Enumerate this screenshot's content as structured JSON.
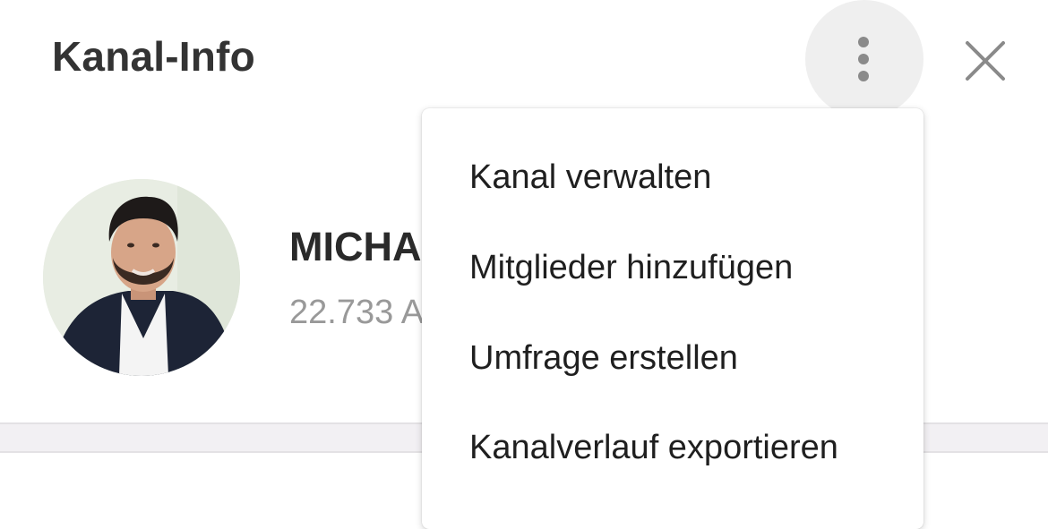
{
  "header": {
    "title": "Kanal-Info",
    "more_icon": "more-vertical-icon",
    "close_icon": "close-icon"
  },
  "channel": {
    "name": "MICHA",
    "subtitle": "22.733 A"
  },
  "menu": {
    "items": [
      {
        "label": "Kanal verwalten"
      },
      {
        "label": "Mitglieder hinzufügen"
      },
      {
        "label": "Umfrage erstellen"
      },
      {
        "label": "Kanalverlauf exportieren"
      }
    ]
  },
  "colors": {
    "title_text": "#333333",
    "subtitle_text": "#999999",
    "icon_gray": "#8a8a8a",
    "divider": "#f2f0f3"
  }
}
